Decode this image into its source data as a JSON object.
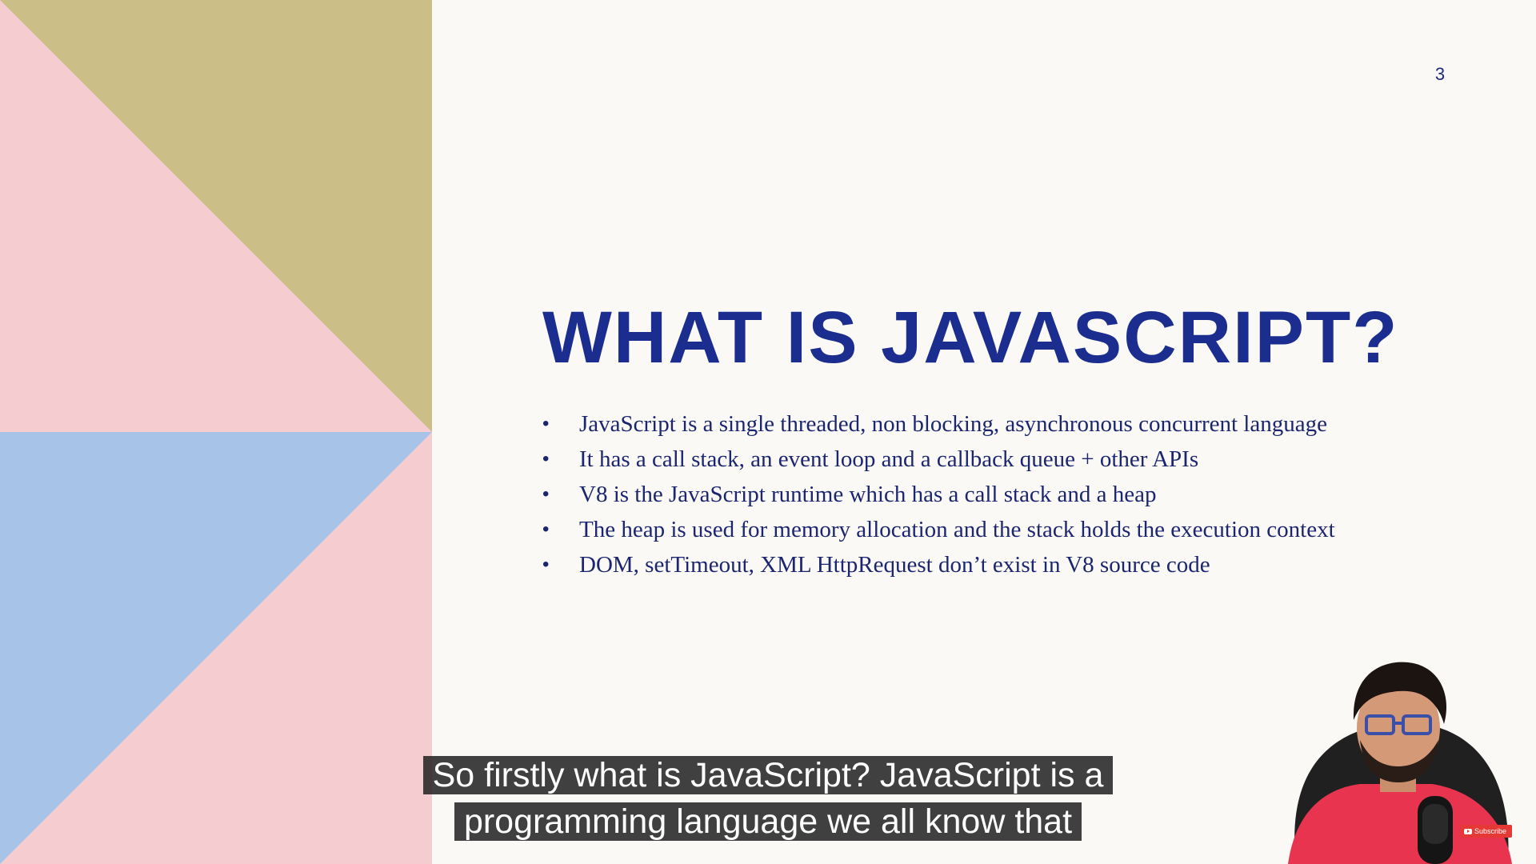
{
  "slide": {
    "number": "3",
    "title": "WHAT IS JAVASCRIPT?",
    "bullets": [
      "JavaScript is a single threaded, non blocking, asynchronous concurrent language",
      "It has a call stack, an event loop and a callback queue + other APIs",
      "V8 is the JavaScript runtime which has a call stack and a heap",
      "The heap is used for memory allocation and the stack holds the execution context",
      "DOM, setTimeout, XML HttpRequest don’t exist in V8 source code"
    ],
    "bullet_symbol": "•"
  },
  "caption": {
    "line1": "So firstly what is JavaScript? JavaScript is a",
    "line2": "programming language we all know that"
  },
  "overlay": {
    "subscribe_label": "Subscribe"
  },
  "colors": {
    "background": "#faf9f6",
    "title": "#1b2e8f",
    "body_text": "#1c2670",
    "panel_pink": "#f5cccf",
    "panel_gold": "#cbbf87",
    "panel_blue": "#a8c3e8",
    "subscribe_red": "#e53935"
  }
}
